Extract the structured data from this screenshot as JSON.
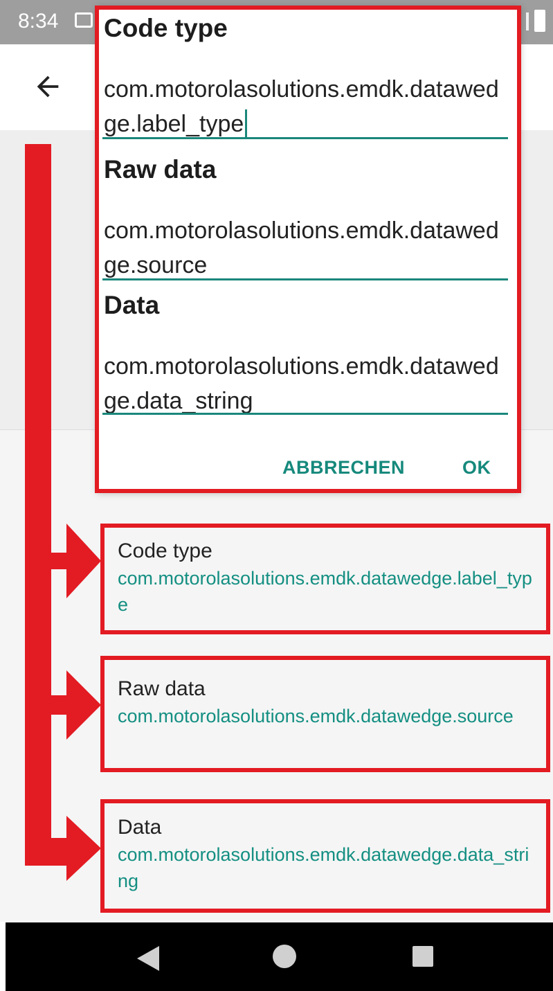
{
  "status_bar": {
    "time": "8:34",
    "icons": [
      "notification-icon",
      "signal-icon",
      "battery-icon"
    ]
  },
  "app_bar": {
    "back_icon": "arrow-left-icon"
  },
  "dialog": {
    "fields": [
      {
        "label": "Code type",
        "value": "com.motorolasolutions.emdk.datawedge.label_type"
      },
      {
        "label": "Raw data",
        "value": "com.motorolasolutions.emdk.datawedge.source"
      },
      {
        "label": "Data",
        "value": "com.motorolasolutions.emdk.datawedge.data_string"
      }
    ],
    "cancel_label": "ABBRECHEN",
    "ok_label": "OK",
    "accent_color": "#16897c"
  },
  "preferences": [
    {
      "title": "Code type",
      "summary": "com.motorolasolutions.emdk.datawedge.label_type"
    },
    {
      "title": "Raw data",
      "summary": "com.motorolasolutions.emdk.datawedge.source"
    },
    {
      "title": "Data",
      "summary": "com.motorolasolutions.emdk.datawedge.data_string"
    }
  ],
  "annotation_color": "#e31b23",
  "nav_bar": {
    "icons": [
      "nav-back-icon",
      "nav-home-icon",
      "nav-recents-icon"
    ]
  }
}
